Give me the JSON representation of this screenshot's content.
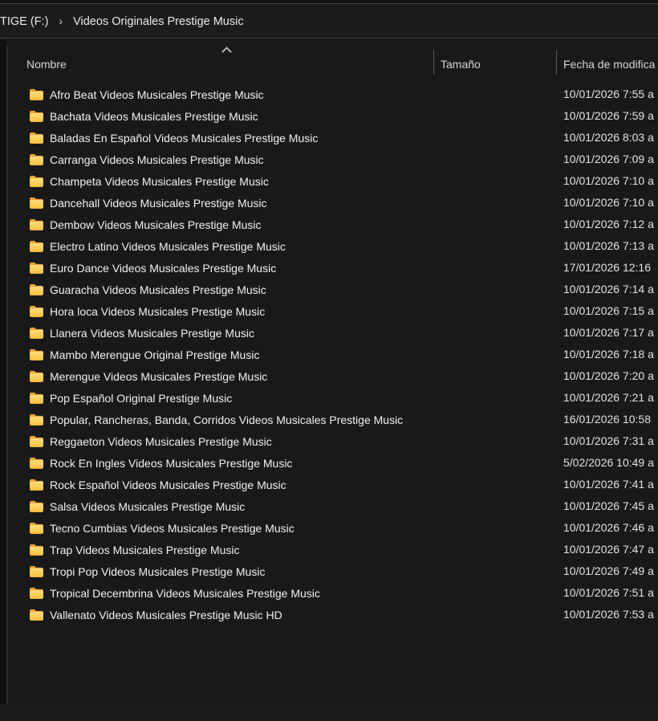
{
  "breadcrumb": {
    "drive": "TIGE  (F:)",
    "separator": "›",
    "folder": "Videos Originales Prestige Music"
  },
  "columns": {
    "name": "Nombre",
    "size": "Tamaño",
    "date": "Fecha de modifica",
    "sort_column": "Nombre",
    "sort_direction": "ascending"
  },
  "colors": {
    "folder_tab": "#e8a33d",
    "folder_front_top": "#ffdc7d",
    "folder_front_bottom": "#f6c23f",
    "panel_bg": "#191919",
    "breadcrumb_bg": "#1c1c1c"
  },
  "files": [
    {
      "icon": "folder",
      "name": "Afro Beat Videos Musicales Prestige Music",
      "size": "",
      "date": "10/01/2026 7:55 a"
    },
    {
      "icon": "folder",
      "name": "Bachata Videos Musicales Prestige Music",
      "size": "",
      "date": "10/01/2026 7:59 a"
    },
    {
      "icon": "folder",
      "name": "Baladas En Español Videos Musicales Prestige Music",
      "size": "",
      "date": "10/01/2026 8:03 a"
    },
    {
      "icon": "folder",
      "name": "Carranga Videos Musicales Prestige Music",
      "size": "",
      "date": "10/01/2026 7:09 a"
    },
    {
      "icon": "folder",
      "name": "Champeta Videos Musicales Prestige Music",
      "size": "",
      "date": "10/01/2026 7:10 a"
    },
    {
      "icon": "folder",
      "name": "Dancehall Videos Musicales Prestige Music",
      "size": "",
      "date": "10/01/2026 7:10 a"
    },
    {
      "icon": "folder",
      "name": "Dembow Videos Musicales Prestige Music",
      "size": "",
      "date": "10/01/2026 7:12 a"
    },
    {
      "icon": "folder",
      "name": "Electro Latino Videos Musicales Prestige Music",
      "size": "",
      "date": "10/01/2026 7:13 a"
    },
    {
      "icon": "folder",
      "name": "Euro Dance Videos Musicales Prestige Music",
      "size": "",
      "date": "17/01/2026 12:16"
    },
    {
      "icon": "folder",
      "name": "Guaracha Videos Musicales Prestige Music",
      "size": "",
      "date": "10/01/2026 7:14 a"
    },
    {
      "icon": "folder",
      "name": "Hora loca Videos Musicales Prestige Music",
      "size": "",
      "date": "10/01/2026 7:15 a"
    },
    {
      "icon": "folder",
      "name": "Llanera Videos Musicales Prestige Music",
      "size": "",
      "date": "10/01/2026 7:17 a"
    },
    {
      "icon": "folder",
      "name": "Mambo Merengue Original Prestige Music",
      "size": "",
      "date": "10/01/2026 7:18 a"
    },
    {
      "icon": "folder",
      "name": "Merengue Videos Musicales Prestige Music",
      "size": "",
      "date": "10/01/2026 7:20 a"
    },
    {
      "icon": "folder",
      "name": "Pop Español Original Prestige Music",
      "size": "",
      "date": "10/01/2026 7:21 a"
    },
    {
      "icon": "folder",
      "name": "Popular, Rancheras, Banda, Corridos Videos Musicales Prestige Music",
      "size": "",
      "date": "16/01/2026 10:58"
    },
    {
      "icon": "folder",
      "name": "Reggaeton Videos Musicales Prestige Music",
      "size": "",
      "date": "10/01/2026 7:31 a"
    },
    {
      "icon": "folder",
      "name": "Rock En Ingles Videos Musicales Prestige Music",
      "size": "",
      "date": "5/02/2026 10:49 a"
    },
    {
      "icon": "folder",
      "name": "Rock Español Videos Musicales Prestige Music",
      "size": "",
      "date": "10/01/2026 7:41 a"
    },
    {
      "icon": "folder",
      "name": "Salsa Videos Musicales Prestige Music",
      "size": "",
      "date": "10/01/2026 7:45 a"
    },
    {
      "icon": "folder",
      "name": "Tecno Cumbias Videos Musicales Prestige Music",
      "size": "",
      "date": "10/01/2026 7:46 a"
    },
    {
      "icon": "folder",
      "name": "Trap Videos Musicales Prestige Music",
      "size": "",
      "date": "10/01/2026 7:47 a"
    },
    {
      "icon": "folder",
      "name": "Tropi Pop Videos Musicales Prestige Music",
      "size": "",
      "date": "10/01/2026 7:49 a"
    },
    {
      "icon": "folder",
      "name": "Tropical Decembrina Videos Musicales Prestige Music",
      "size": "",
      "date": "10/01/2026 7:51 a"
    },
    {
      "icon": "folder",
      "name": "Vallenato Videos Musicales Prestige Music HD",
      "size": "",
      "date": "10/01/2026 7:53 a"
    }
  ]
}
